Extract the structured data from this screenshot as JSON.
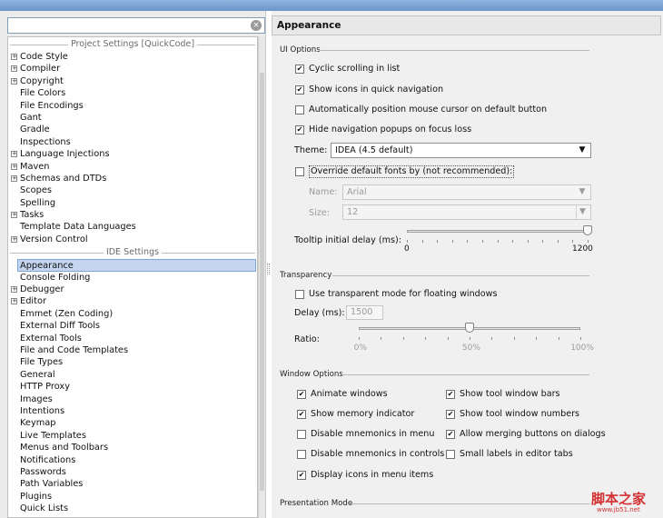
{
  "search": {
    "value": "",
    "clear_icon": "×"
  },
  "sidebar": {
    "project_section": "Project Settings [QuickCode]",
    "project_items": [
      {
        "label": "Code Style",
        "expandable": true
      },
      {
        "label": "Compiler",
        "expandable": true
      },
      {
        "label": "Copyright",
        "expandable": true
      },
      {
        "label": "File Colors",
        "expandable": false
      },
      {
        "label": "File Encodings",
        "expandable": false
      },
      {
        "label": "Gant",
        "expandable": false
      },
      {
        "label": "Gradle",
        "expandable": false
      },
      {
        "label": "Inspections",
        "expandable": false
      },
      {
        "label": "Language Injections",
        "expandable": true
      },
      {
        "label": "Maven",
        "expandable": true
      },
      {
        "label": "Schemas and DTDs",
        "expandable": true
      },
      {
        "label": "Scopes",
        "expandable": false
      },
      {
        "label": "Spelling",
        "expandable": false
      },
      {
        "label": "Tasks",
        "expandable": true
      },
      {
        "label": "Template Data Languages",
        "expandable": false
      },
      {
        "label": "Version Control",
        "expandable": true
      }
    ],
    "ide_section": "IDE Settings",
    "ide_items": [
      {
        "label": "Appearance",
        "expandable": false,
        "selected": true
      },
      {
        "label": "Console Folding",
        "expandable": false
      },
      {
        "label": "Debugger",
        "expandable": true
      },
      {
        "label": "Editor",
        "expandable": true
      },
      {
        "label": "Emmet (Zen Coding)",
        "expandable": false
      },
      {
        "label": "External Diff Tools",
        "expandable": false
      },
      {
        "label": "External Tools",
        "expandable": false
      },
      {
        "label": "File and Code Templates",
        "expandable": false
      },
      {
        "label": "File Types",
        "expandable": false
      },
      {
        "label": "General",
        "expandable": false
      },
      {
        "label": "HTTP Proxy",
        "expandable": false
      },
      {
        "label": "Images",
        "expandable": false
      },
      {
        "label": "Intentions",
        "expandable": false
      },
      {
        "label": "Keymap",
        "expandable": false
      },
      {
        "label": "Live Templates",
        "expandable": false
      },
      {
        "label": "Menus and Toolbars",
        "expandable": false
      },
      {
        "label": "Notifications",
        "expandable": false
      },
      {
        "label": "Passwords",
        "expandable": false
      },
      {
        "label": "Path Variables",
        "expandable": false
      },
      {
        "label": "Plugins",
        "expandable": false
      },
      {
        "label": "Quick Lists",
        "expandable": false
      }
    ]
  },
  "page": {
    "title": "Appearance",
    "ui_options": {
      "group_label": "UI Options",
      "cyclic_scrolling": {
        "label": "Cyclic scrolling in list",
        "checked": true
      },
      "show_icons_quick_nav": {
        "label": "Show icons in quick navigation",
        "checked": true
      },
      "auto_position_cursor": {
        "label": "Automatically position mouse cursor on default button",
        "checked": false
      },
      "hide_nav_popups": {
        "label": "Hide navigation popups on focus loss",
        "checked": true
      },
      "theme_label": "Theme:",
      "theme_value": "IDEA (4.5 default)",
      "override_fonts": {
        "label": "Override default fonts by (not recommended):",
        "checked": false
      },
      "name_label": "Name:",
      "name_value": "Arial",
      "size_label": "Size:",
      "size_value": "12",
      "tooltip_label": "Tooltip initial delay (ms):",
      "tooltip_min": "0",
      "tooltip_max": "1200",
      "tooltip_value": 1200
    },
    "transparency": {
      "group_label": "Transparency",
      "transparent_mode": {
        "label": "Use transparent mode for floating windows",
        "checked": false
      },
      "delay_label": "Delay (ms):",
      "delay_value": "1500",
      "ratio_label": "Ratio:",
      "ratio_ticks": [
        "0%",
        "50%",
        "100%"
      ],
      "ratio_value": 0.5
    },
    "window_options": {
      "group_label": "Window Options",
      "animate_windows": {
        "label": "Animate windows",
        "checked": true
      },
      "show_memory": {
        "label": "Show memory indicator",
        "checked": true
      },
      "disable_mnemonics_menu": {
        "label": "Disable mnemonics in menu",
        "checked": false
      },
      "disable_mnemonics_controls": {
        "label": "Disable mnemonics in controls",
        "checked": false
      },
      "display_icons_menu": {
        "label": "Display icons in menu items",
        "checked": true
      },
      "show_tool_bars": {
        "label": "Show tool window bars",
        "checked": true
      },
      "show_tool_numbers": {
        "label": "Show tool window numbers",
        "checked": true
      },
      "allow_merging": {
        "label": "Allow merging buttons on dialogs",
        "checked": true
      },
      "small_labels": {
        "label": "Small labels in editor tabs",
        "checked": false
      }
    },
    "presentation_mode": {
      "group_label": "Presentation Mode"
    }
  },
  "watermark": {
    "text": "脚本之家",
    "url": "www.jb51.net"
  },
  "colors": {
    "selection": "#c4d6ef",
    "titlebar": "#7aa0d3",
    "watermark": "#d43030"
  }
}
